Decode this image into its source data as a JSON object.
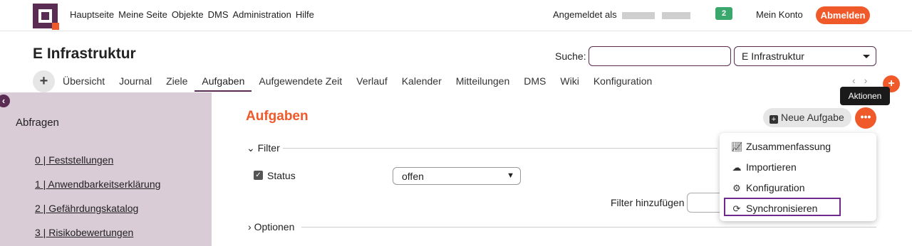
{
  "topnav": {
    "items": [
      "Hauptseite",
      "Meine Seite",
      "Objekte",
      "DMS",
      "Administration",
      "Hilfe"
    ],
    "logged_in_label": "Angemeldet als",
    "notification_count": "2",
    "account": "Mein Konto",
    "logout": "Abmelden"
  },
  "project": {
    "title": "E Infrastruktur",
    "search_label": "Suche:",
    "selected_project": "E Infrastruktur"
  },
  "tabs": [
    "Übersicht",
    "Journal",
    "Ziele",
    "Aufgaben",
    "Aufgewendete Zeit",
    "Verlauf",
    "Kalender",
    "Mitteilungen",
    "DMS",
    "Wiki",
    "Konfiguration"
  ],
  "active_tab": "Aufgaben",
  "tooltip": "Aktionen",
  "sidebar": {
    "heading": "Abfragen",
    "queries": [
      "0 | Feststellungen",
      "1 | Anwendbarkeitserklärung",
      "2 | Gefährdungskatalog",
      "3 | Risikobewertungen"
    ]
  },
  "main": {
    "heading": "Aufgaben",
    "new_task": "Neue Aufgabe",
    "filter_legend": "Filter",
    "status_label": "Status",
    "status_value": "offen",
    "add_filter_label": "Filter hinzufügen",
    "options_legend": "Optionen"
  },
  "actions_menu": {
    "items": [
      {
        "label": "Zusammenfassung",
        "icon": "chart-line-icon"
      },
      {
        "label": "Importieren",
        "icon": "cloud-upload-icon"
      },
      {
        "label": "Konfiguration",
        "icon": "gear-icon"
      },
      {
        "label": "Synchronisieren",
        "icon": "sync-icon"
      }
    ]
  },
  "colors": {
    "brand": "#5a2b53",
    "accent": "#f0592a",
    "sidebar_bg": "#d9ccd6",
    "badge_green": "#3aa76d"
  }
}
